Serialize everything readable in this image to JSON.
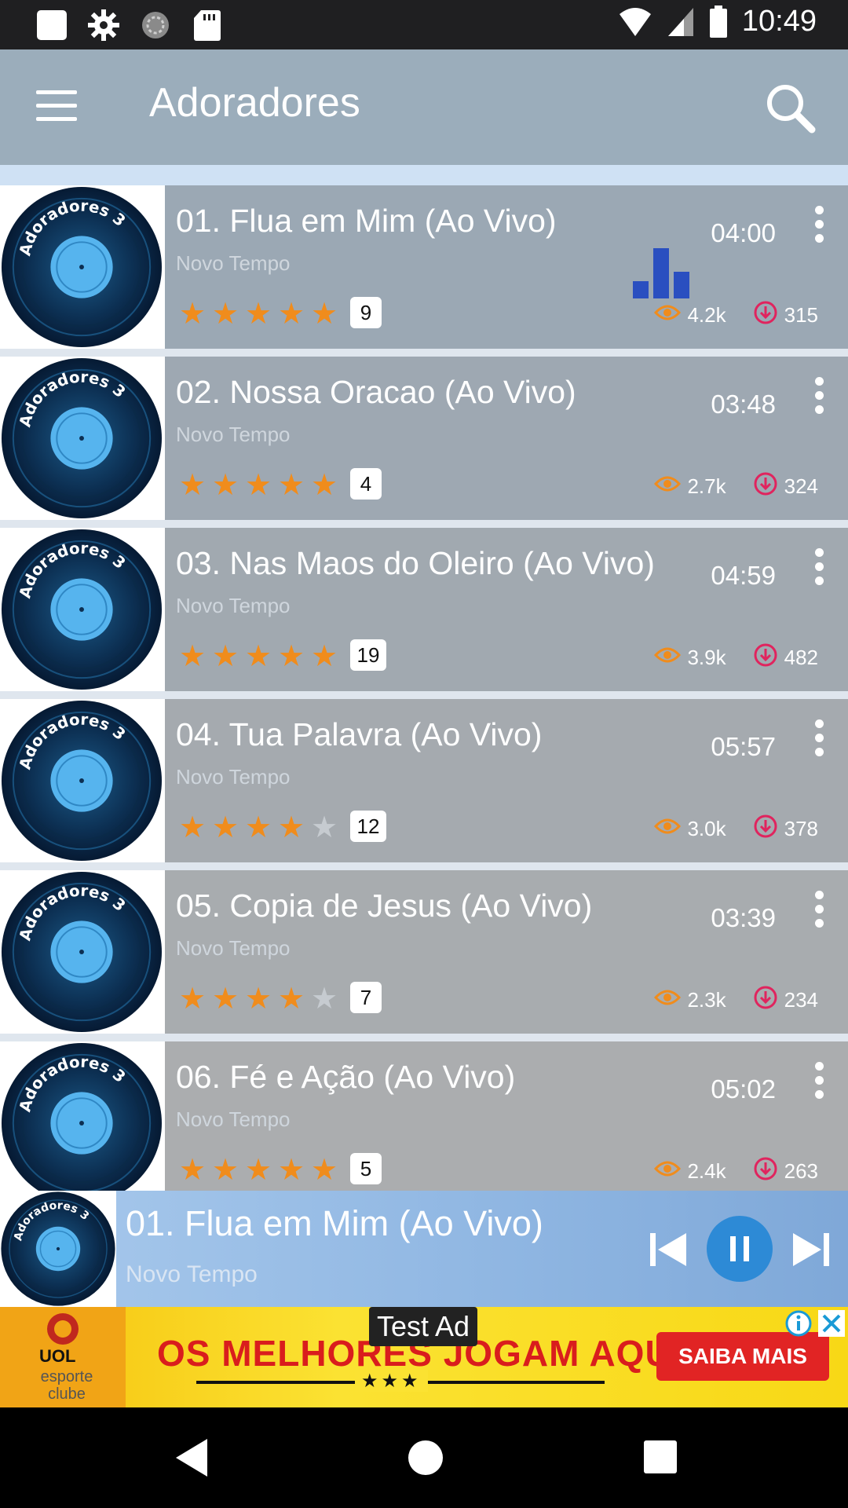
{
  "status_bar": {
    "time": "10:49",
    "left_icons": [
      "sim-icon",
      "gear-icon",
      "sync-icon",
      "sd-card-icon"
    ],
    "right_icons": [
      "wifi-icon",
      "signal-icon",
      "battery-icon"
    ]
  },
  "app_bar": {
    "title": "Adoradores",
    "menu_icon": "menu-icon",
    "search_icon": "search-icon"
  },
  "cover": {
    "label": "Adoradores 3"
  },
  "tracks": [
    {
      "title": "01. Flua em Mim (Ao Vivo)",
      "artist": "Novo Tempo",
      "duration": "04:00",
      "stars": 5,
      "rating_count": "9",
      "views": "4.2k",
      "downloads": "315",
      "playing": true
    },
    {
      "title": "02. Nossa Oracao (Ao Vivo)",
      "artist": "Novo Tempo",
      "duration": "03:48",
      "stars": 5,
      "rating_count": "4",
      "views": "2.7k",
      "downloads": "324",
      "playing": false
    },
    {
      "title": "03. Nas Maos do Oleiro (Ao Vivo)",
      "artist": "Novo Tempo",
      "duration": "04:59",
      "stars": 5,
      "rating_count": "19",
      "views": "3.9k",
      "downloads": "482",
      "playing": false
    },
    {
      "title": "04. Tua Palavra (Ao Vivo)",
      "artist": "Novo Tempo",
      "duration": "05:57",
      "stars": 4,
      "rating_count": "12",
      "views": "3.0k",
      "downloads": "378",
      "playing": false
    },
    {
      "title": "05. Copia de Jesus (Ao Vivo)",
      "artist": "Novo Tempo",
      "duration": "03:39",
      "stars": 4,
      "rating_count": "7",
      "views": "2.3k",
      "downloads": "234",
      "playing": false
    },
    {
      "title": "06. Fé e Ação (Ao Vivo)",
      "artist": "Novo Tempo",
      "duration": "05:02",
      "stars": 5,
      "rating_count": "5",
      "views": "2.4k",
      "downloads": "263",
      "playing": false
    }
  ],
  "now_playing": {
    "title": "01. Flua em Mim (Ao Vivo)",
    "artist": "Novo Tempo",
    "controls": [
      "previous-icon",
      "pause-icon",
      "next-icon"
    ]
  },
  "ad": {
    "tag": "Test Ad",
    "brand": "UOL",
    "brand_sub": "esporte clube",
    "headline": "OS MELHORES JOGAM AQUI",
    "stars": "★★★",
    "cta": "SAIBA MAIS"
  },
  "colors": {
    "app_bar": "#9badbb",
    "star_on": "#f08c1c",
    "views_icon": "#f08c1c",
    "downloads_icon": "#e0245e",
    "eq_bars": "#2a4fc0",
    "play_button": "#2d8ad6"
  },
  "nav_bar": [
    "back-icon",
    "home-icon",
    "recents-icon"
  ]
}
